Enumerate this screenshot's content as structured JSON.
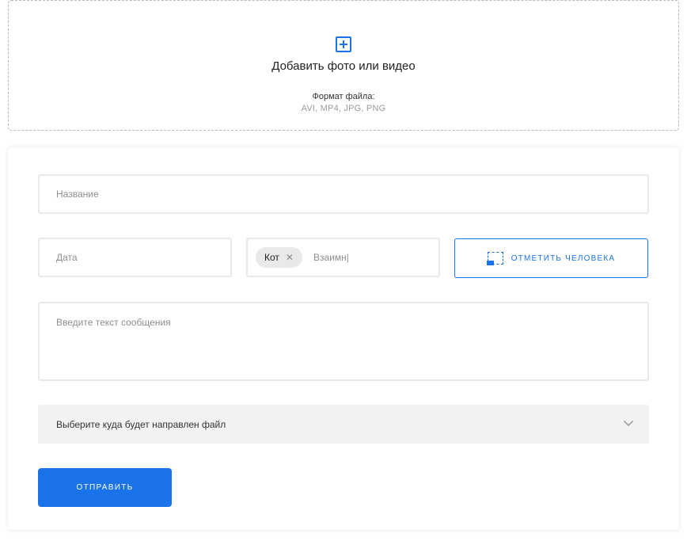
{
  "upload": {
    "title": "Добавить фото или видео",
    "format_label": "Формат файла:",
    "format_values": "AVI, MP4, JPG, PNG",
    "icon": "plus-square-icon"
  },
  "form": {
    "title_placeholder": "Название",
    "date_placeholder": "Дата",
    "tags": {
      "chips": [
        "Кот"
      ],
      "remove_icon": "✕",
      "input_value": "Взаимн|"
    },
    "mark_person_label": "ОТМЕТИТЬ ЧЕЛОВЕКА",
    "message_placeholder": "Введите текст сообщения",
    "destination_select": {
      "label": "Выберите куда будет направлен файл",
      "chevron": "❯"
    },
    "send_label": "ОТПРАВИТЬ"
  },
  "colors": {
    "accent": "#1a73e8",
    "field_border": "#e9e9e9",
    "select_bg": "#f2f2f2"
  }
}
